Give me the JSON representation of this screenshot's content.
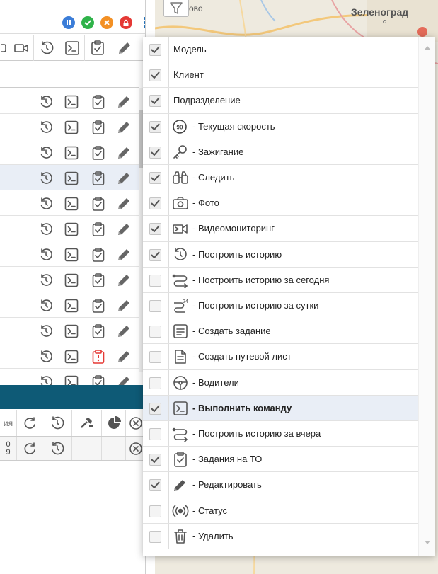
{
  "map": {
    "city_label": "Зеленоград",
    "stub_label": "ово"
  },
  "bottom_panel": {
    "header_cut_label": "ия",
    "row_value_1": "0",
    "row_value_2": "9"
  },
  "status_indicators": [
    {
      "name": "pause",
      "color": "#3b7dd8"
    },
    {
      "name": "ok",
      "color": "#2fb34a"
    },
    {
      "name": "warning",
      "color": "#f39024"
    },
    {
      "name": "lock",
      "color": "#e53935"
    }
  ],
  "menu": {
    "items": [
      {
        "label": "Модель",
        "checked": true,
        "icon": "none",
        "bold": false
      },
      {
        "label": "Клиент",
        "checked": true,
        "icon": "none",
        "bold": false
      },
      {
        "label": "Подразделение",
        "checked": true,
        "icon": "none",
        "bold": false
      },
      {
        "label": "- Текущая скорость",
        "checked": true,
        "icon": "speed-icon",
        "bold": false
      },
      {
        "label": "- Зажигание",
        "checked": true,
        "icon": "key-icon",
        "bold": false
      },
      {
        "label": "- Следить",
        "checked": true,
        "icon": "binoculars-icon",
        "bold": false
      },
      {
        "label": "- Фото",
        "checked": true,
        "icon": "camera-icon",
        "bold": false
      },
      {
        "label": "- Видеомониторинг",
        "checked": true,
        "icon": "video-icon",
        "bold": false
      },
      {
        "label": "- Построить историю",
        "checked": true,
        "icon": "history-icon",
        "bold": false
      },
      {
        "label": "- Построить историю за сегодня",
        "checked": false,
        "icon": "route-icon",
        "bold": false
      },
      {
        "label": "- Построить историю за сутки",
        "checked": false,
        "icon": "route24-icon",
        "bold": false
      },
      {
        "label": "- Создать задание",
        "checked": false,
        "icon": "task-icon",
        "bold": false
      },
      {
        "label": "- Создать путевой лист",
        "checked": false,
        "icon": "document-icon",
        "bold": false
      },
      {
        "label": "- Водители",
        "checked": false,
        "icon": "steering-wheel-icon",
        "bold": false
      },
      {
        "label": "- Выполнить команду",
        "checked": true,
        "icon": "terminal-icon",
        "bold": true
      },
      {
        "label": "- Построить историю за вчера",
        "checked": false,
        "icon": "route-icon",
        "bold": false
      },
      {
        "label": "- Задания на ТО",
        "checked": true,
        "icon": "clipboard-check-icon",
        "bold": false
      },
      {
        "label": "- Редактировать",
        "checked": true,
        "icon": "pencil-icon",
        "bold": false
      },
      {
        "label": "- Статус",
        "checked": false,
        "icon": "broadcast-icon",
        "bold": false
      },
      {
        "label": "- Удалить",
        "checked": false,
        "icon": "trash-icon",
        "bold": false
      }
    ]
  }
}
